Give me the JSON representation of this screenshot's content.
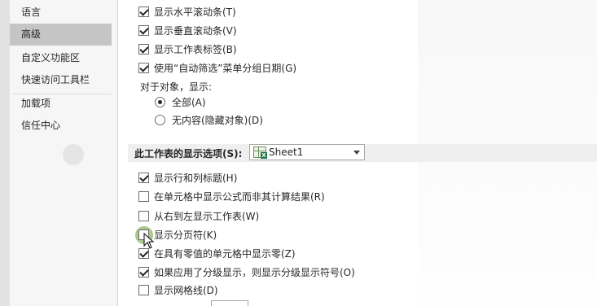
{
  "sidebar": {
    "items": [
      {
        "label": "语言",
        "selected": false
      },
      {
        "label": "高级",
        "selected": true
      },
      {
        "label": "自定义功能区",
        "selected": false
      },
      {
        "label": "快速访问工具栏",
        "selected": false
      },
      {
        "label": "加载项",
        "selected": false
      },
      {
        "label": "信任中心",
        "selected": false
      }
    ]
  },
  "workbook_options": [
    {
      "label": "显示水平滚动条(T)",
      "checked": true
    },
    {
      "label": "显示垂直滚动条(V)",
      "checked": true
    },
    {
      "label": "显示工作表标签(B)",
      "checked": true
    },
    {
      "label": "使用“自动筛选”菜单分组日期(G)",
      "checked": true
    }
  ],
  "objects": {
    "label": "对于对象，显示:",
    "options": [
      {
        "label": "全部(A)",
        "selected": true
      },
      {
        "label": "无内容(隐藏对象)(D)",
        "selected": false
      }
    ]
  },
  "sheet_section": {
    "title": "此工作表的显示选项(S):",
    "selected_sheet": "Sheet1"
  },
  "sheet_options": [
    {
      "label": "显示行和列标题(H)",
      "checked": true
    },
    {
      "label": "在单元格中显示公式而非其计算结果(R)",
      "checked": false
    },
    {
      "label": "从右到左显示工作表(W)",
      "checked": false
    },
    {
      "label": "显示分页符(K)",
      "checked": false
    },
    {
      "label": "在具有零值的单元格中显示零(Z)",
      "checked": true
    },
    {
      "label": "如果应用了分级显示，则显示分级显示符号(O)",
      "checked": true
    },
    {
      "label": "显示网格线(D)",
      "checked": false
    }
  ],
  "icons": {
    "cursor": "mouse-pointer-icon",
    "sheet": "excel-sheet-icon",
    "dropdown": "chevron-down-icon"
  },
  "colors": {
    "selected_sidebar": "#c5c5c5",
    "section_bar": "#efefef",
    "excel_green": "#217346"
  }
}
